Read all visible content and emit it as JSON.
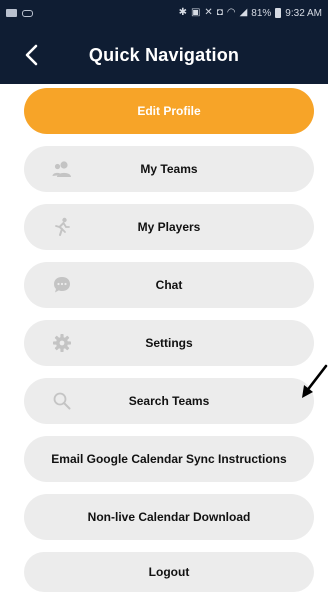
{
  "status_bar": {
    "battery": "81%",
    "time": "9:32 AM"
  },
  "header": {
    "title": "Quick Navigation",
    "back_icon": "chevron-left-icon"
  },
  "menu": {
    "items": [
      {
        "label": "Edit Profile",
        "icon": ""
      },
      {
        "label": "My Teams",
        "icon": "team-icon"
      },
      {
        "label": "My Players",
        "icon": "player-icon"
      },
      {
        "label": "Chat",
        "icon": "chat-icon"
      },
      {
        "label": "Settings",
        "icon": "gear-icon"
      },
      {
        "label": "Search Teams",
        "icon": "search-icon"
      },
      {
        "label": "Email Google Calendar Sync Instructions",
        "icon": ""
      },
      {
        "label": "Non-live Calendar Download",
        "icon": ""
      },
      {
        "label": "Logout",
        "icon": ""
      }
    ]
  },
  "colors": {
    "header_bg": "#0f1d33",
    "accent": "#f7a428",
    "button_bg": "#ececec",
    "icon_gray": "#c4c4c4"
  }
}
